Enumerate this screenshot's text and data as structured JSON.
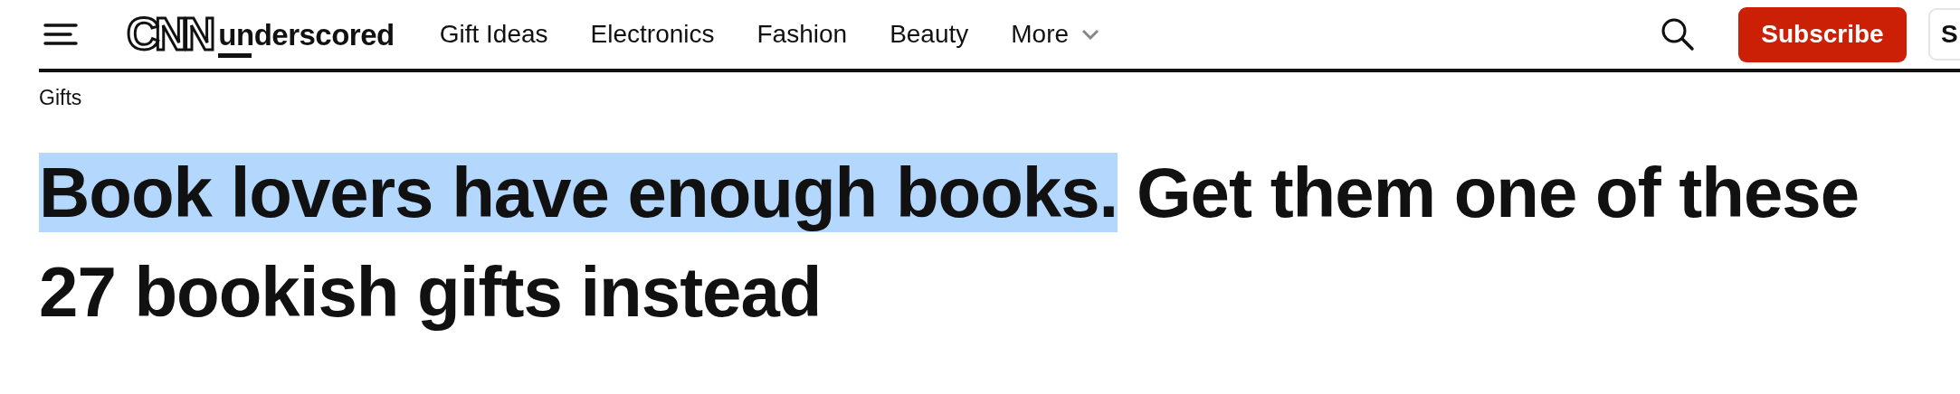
{
  "header": {
    "logo": {
      "mark": "CNN",
      "wordmark": "underscored"
    },
    "nav": [
      {
        "label": "Gift Ideas",
        "kind": "link"
      },
      {
        "label": "Electronics",
        "kind": "link"
      },
      {
        "label": "Fashion",
        "kind": "link"
      },
      {
        "label": "Beauty",
        "kind": "link"
      },
      {
        "label": "More",
        "kind": "dropdown"
      }
    ],
    "subscribe_button": "Subscribe",
    "next_button": "S"
  },
  "breadcrumb": "Gifts",
  "headline": [
    {
      "text": "Book lovers have enough books.",
      "selected": true
    },
    {
      "text": " Get them one of these 27 bookish gifts instead",
      "selected": false
    }
  ]
}
